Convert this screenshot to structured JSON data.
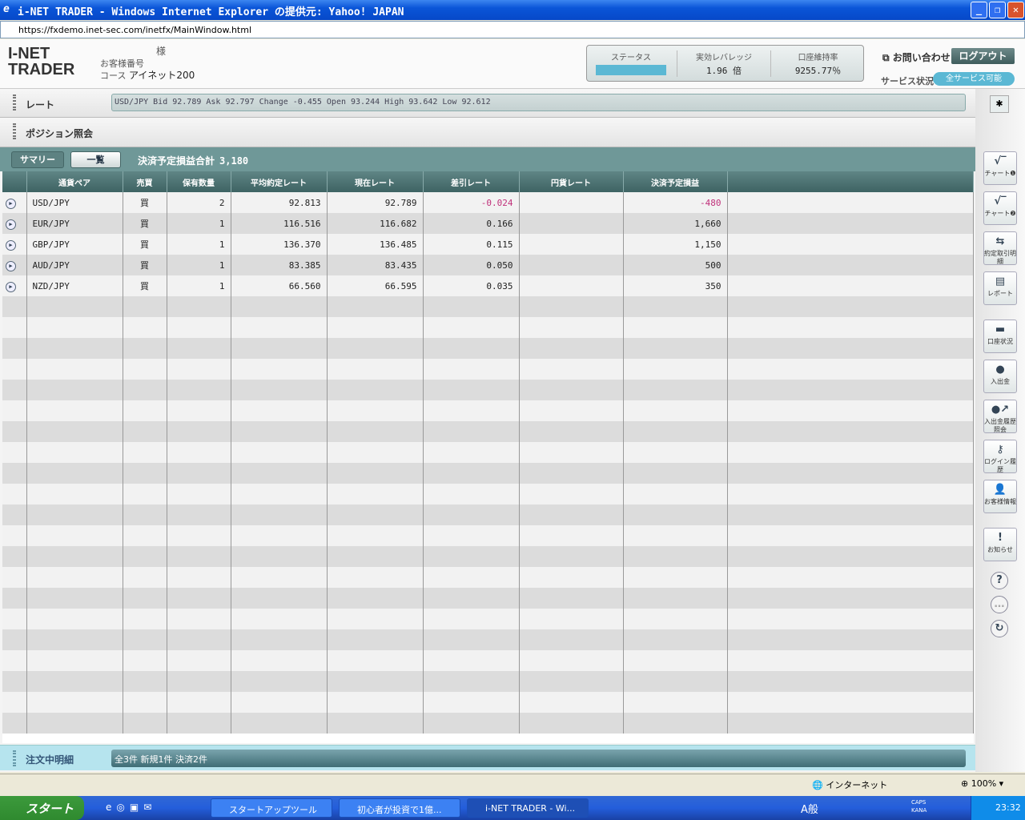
{
  "window": {
    "title": "i-NET TRADER - Windows Internet Explorer の提供元: Yahoo! JAPAN",
    "url": "https://fxdemo.inet-sec.com/inetfx/MainWindow.html"
  },
  "header": {
    "logo": "i-NET TRADER",
    "honorific": "様",
    "customer_no_label": "お客様番号",
    "course_label": "コース",
    "course_value": "アイネット200",
    "status_label": "ステータス",
    "leverage_label": "実効レバレッジ",
    "leverage_value": "1.96 倍",
    "maintenance_label": "口座維持率",
    "maintenance_value": "9255.77％",
    "contact": "お問い合わせ",
    "logout": "ログアウト",
    "service_label": "サービス状況",
    "service_value": "全サービス可能",
    "status_color": "#5bb8d4"
  },
  "rate": {
    "label": "レート",
    "ticker": "USD/JPY Bid 92.789 Ask 92.797 Change -0.455 Open 93.244 High 93.642 Low 92.612"
  },
  "positions": {
    "label": "ポジション照会",
    "tab_summary": "サマリー",
    "tab_list": "一覧",
    "total_label": "決済予定損益合計",
    "total_value": "3,180",
    "columns": [
      "通貨ペア",
      "売買",
      "保有数量",
      "平均約定レート",
      "現在レート",
      "差引レート",
      "円貨レート",
      "決済予定損益"
    ],
    "rows": [
      {
        "pair": "USD/JPY",
        "side": "買",
        "qty": "2",
        "avg": "92.813",
        "cur": "92.789",
        "diff": "-0.024",
        "jpy": "",
        "pl": "-480"
      },
      {
        "pair": "EUR/JPY",
        "side": "買",
        "qty": "1",
        "avg": "116.516",
        "cur": "116.682",
        "diff": "0.166",
        "jpy": "",
        "pl": "1,660"
      },
      {
        "pair": "GBP/JPY",
        "side": "買",
        "qty": "1",
        "avg": "136.370",
        "cur": "136.485",
        "diff": "0.115",
        "jpy": "",
        "pl": "1,150"
      },
      {
        "pair": "AUD/JPY",
        "side": "買",
        "qty": "1",
        "avg": "83.385",
        "cur": "83.435",
        "diff": "0.050",
        "jpy": "",
        "pl": "500"
      },
      {
        "pair": "NZD/JPY",
        "side": "買",
        "qty": "1",
        "avg": "66.560",
        "cur": "66.595",
        "diff": "0.035",
        "jpy": "",
        "pl": "350"
      }
    ]
  },
  "orders": {
    "label": "注文中明細",
    "summary": "全3件 新規1件 決済2件"
  },
  "sidebar": {
    "items": [
      "チャート❶",
      "チャート❷",
      "約定取引明細",
      "レポート",
      "口座状況",
      "入出金",
      "入出金履歴照会",
      "ログイン履歴",
      "お客様情報",
      "お知らせ"
    ]
  },
  "ie_status": {
    "zone": "インターネット",
    "zoom": "100%"
  },
  "taskbar": {
    "start": "スタート",
    "tasks": [
      "スタートアップツール",
      "初心者が投資で1億...",
      "i-NET TRADER - Wi..."
    ],
    "ime": "A般",
    "caps": "CAPS",
    "kana": "KANA",
    "clock": "23:32"
  }
}
